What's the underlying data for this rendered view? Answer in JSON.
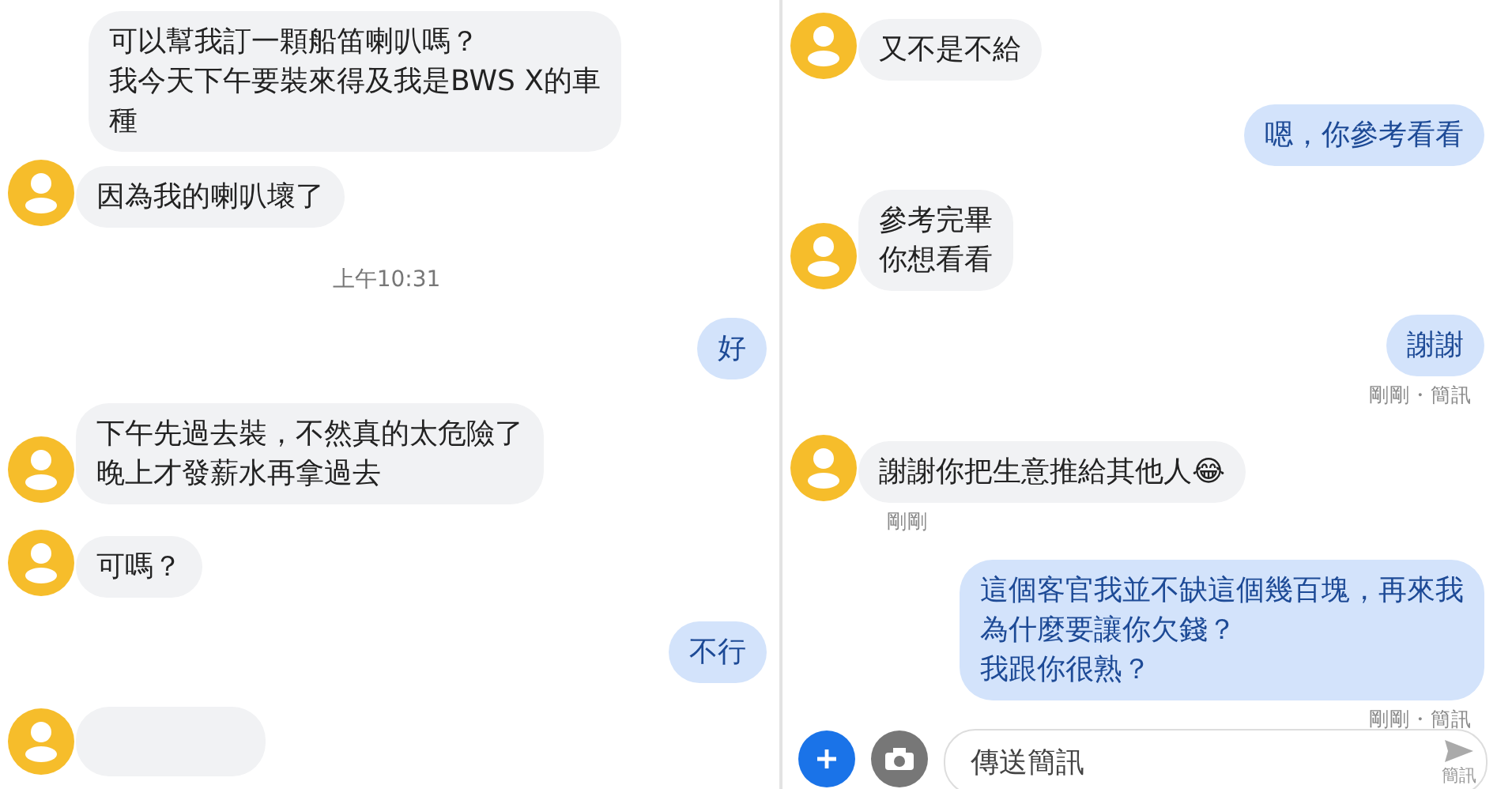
{
  "panels": [
    {
      "messages": [
        {
          "kind": "incoming",
          "avatar": false,
          "lines": [
            "可以幫我訂一顆船笛喇叭嗎？",
            "我今天下午要裝來得及我是BWS X的車",
            "種"
          ]
        },
        {
          "kind": "incoming",
          "avatar": true,
          "lines": [
            "因為我的喇叭壞了"
          ]
        },
        {
          "kind": "timestamp",
          "text": "上午10:31"
        },
        {
          "kind": "outgoing",
          "lines": [
            "好"
          ]
        },
        {
          "kind": "incoming",
          "avatar": true,
          "lines": [
            "下午先過去裝，不然真的太危險了",
            "晚上才發薪水再拿過去"
          ]
        },
        {
          "kind": "incoming",
          "avatar": true,
          "lines": [
            "可嗎？"
          ]
        },
        {
          "kind": "outgoing",
          "lines": [
            "不行"
          ]
        },
        {
          "kind": "incoming",
          "avatar": true
        }
      ]
    },
    {
      "messages": [
        {
          "kind": "incoming",
          "avatar": true,
          "lines": [
            "又不是不給"
          ]
        },
        {
          "kind": "outgoing",
          "lines": [
            "嗯，你參考看看"
          ]
        },
        {
          "kind": "incoming",
          "avatar": true,
          "lines": [
            "參考完畢",
            "你想看看"
          ]
        },
        {
          "kind": "outgoing",
          "lines": [
            "謝謝"
          ],
          "status": "剛剛・簡訊"
        },
        {
          "kind": "incoming",
          "avatar": true,
          "lines": [
            "謝謝你把生意推給其他人😂"
          ],
          "status": "剛剛"
        },
        {
          "kind": "outgoing",
          "lines": [
            "這個客官我並不缺這個幾百塊，再來我",
            "為什麼要讓你欠錢？",
            "我跟你很熟？"
          ],
          "status": "剛剛・簡訊"
        }
      ],
      "composer": {
        "placeholder": "傳送簡訊",
        "send_label": "簡訊"
      }
    }
  ]
}
